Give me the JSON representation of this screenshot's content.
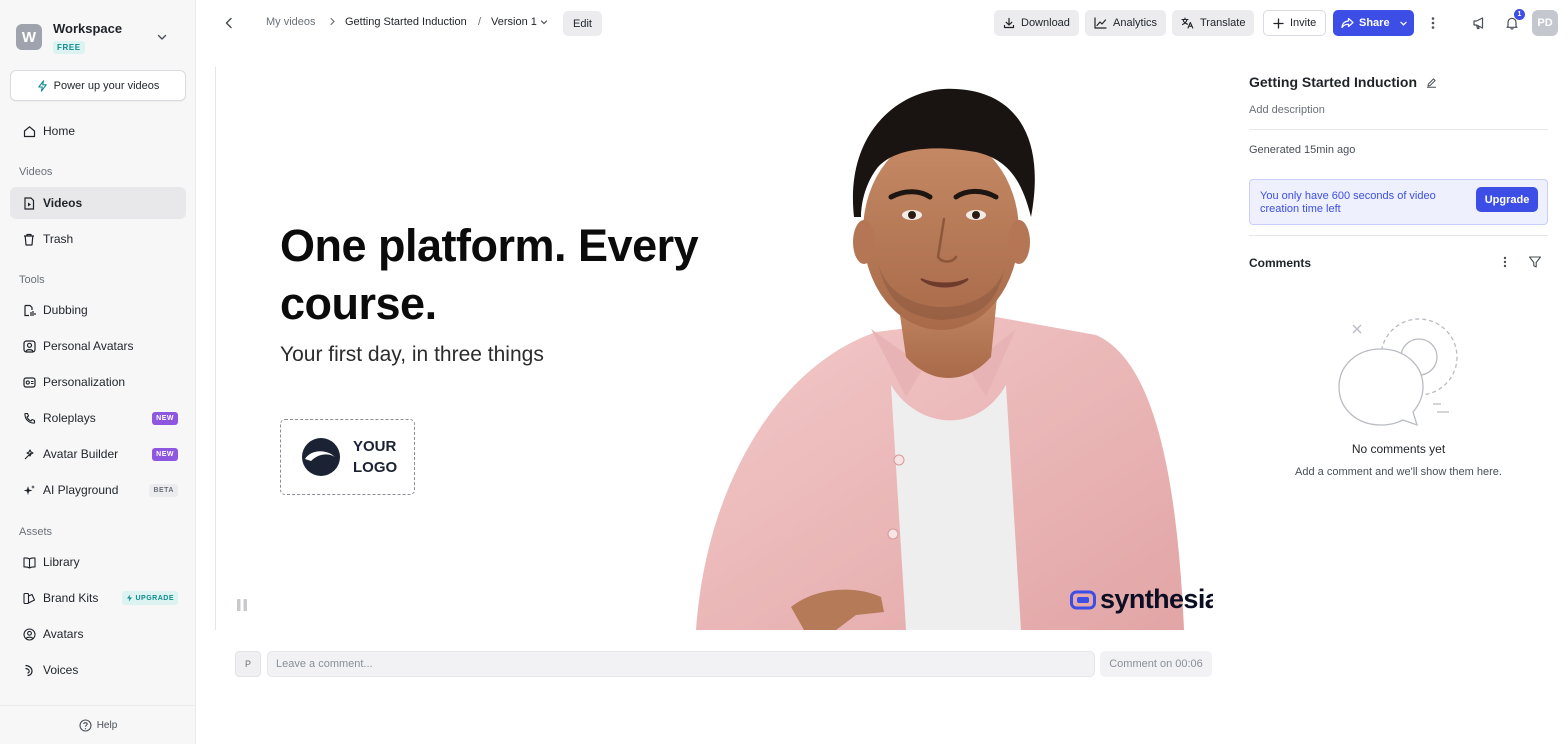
{
  "workspace": {
    "initial": "W",
    "name": "Workspace",
    "plan": "FREE"
  },
  "sidebar": {
    "power_up": "Power up your videos",
    "home": "Home",
    "section_videos": "Videos",
    "videos": "Videos",
    "trash": "Trash",
    "section_tools": "Tools",
    "dubbing": "Dubbing",
    "personal_avatars": "Personal Avatars",
    "personalization": "Personalization",
    "roleplays": "Roleplays",
    "roleplays_tag": "NEW",
    "avatar_builder": "Avatar Builder",
    "avatar_builder_tag": "NEW",
    "ai_playground": "AI Playground",
    "ai_playground_tag": "BETA",
    "section_assets": "Assets",
    "library": "Library",
    "brand_kits": "Brand Kits",
    "brand_kits_tag": "UPGRADE",
    "avatars": "Avatars",
    "voices": "Voices",
    "help": "Help"
  },
  "topbar": {
    "crumb_root": "My videos",
    "crumb_video": "Getting Started Induction",
    "crumb_sep": "/",
    "version": "Version 1",
    "edit": "Edit",
    "download": "Download",
    "analytics": "Analytics",
    "translate": "Translate",
    "invite": "Invite",
    "share": "Share",
    "notification_count": "1",
    "user_initials": "PD"
  },
  "video": {
    "headline": "One platform. Every course.",
    "subtitle": "Your first day, in three things",
    "logo_text_1": "YOUR",
    "logo_text_2": "LOGO",
    "brand": "synthesia"
  },
  "comment_bar": {
    "avatar_initial": "P",
    "placeholder": "Leave a comment...",
    "timestamp_label": "Comment on 00:06"
  },
  "panel": {
    "title": "Getting Started Induction",
    "description_placeholder": "Add description",
    "generated": "Generated 15min ago",
    "alert": "You only have 600 seconds of video creation time left",
    "upgrade": "Upgrade",
    "comments_heading": "Comments",
    "empty_title": "No comments yet",
    "empty_sub": "Add a comment and we'll show them here."
  },
  "colors": {
    "accent": "#3d4ee6",
    "new_tag": "#8e57e0",
    "free_badge": "#0f8b8d"
  }
}
